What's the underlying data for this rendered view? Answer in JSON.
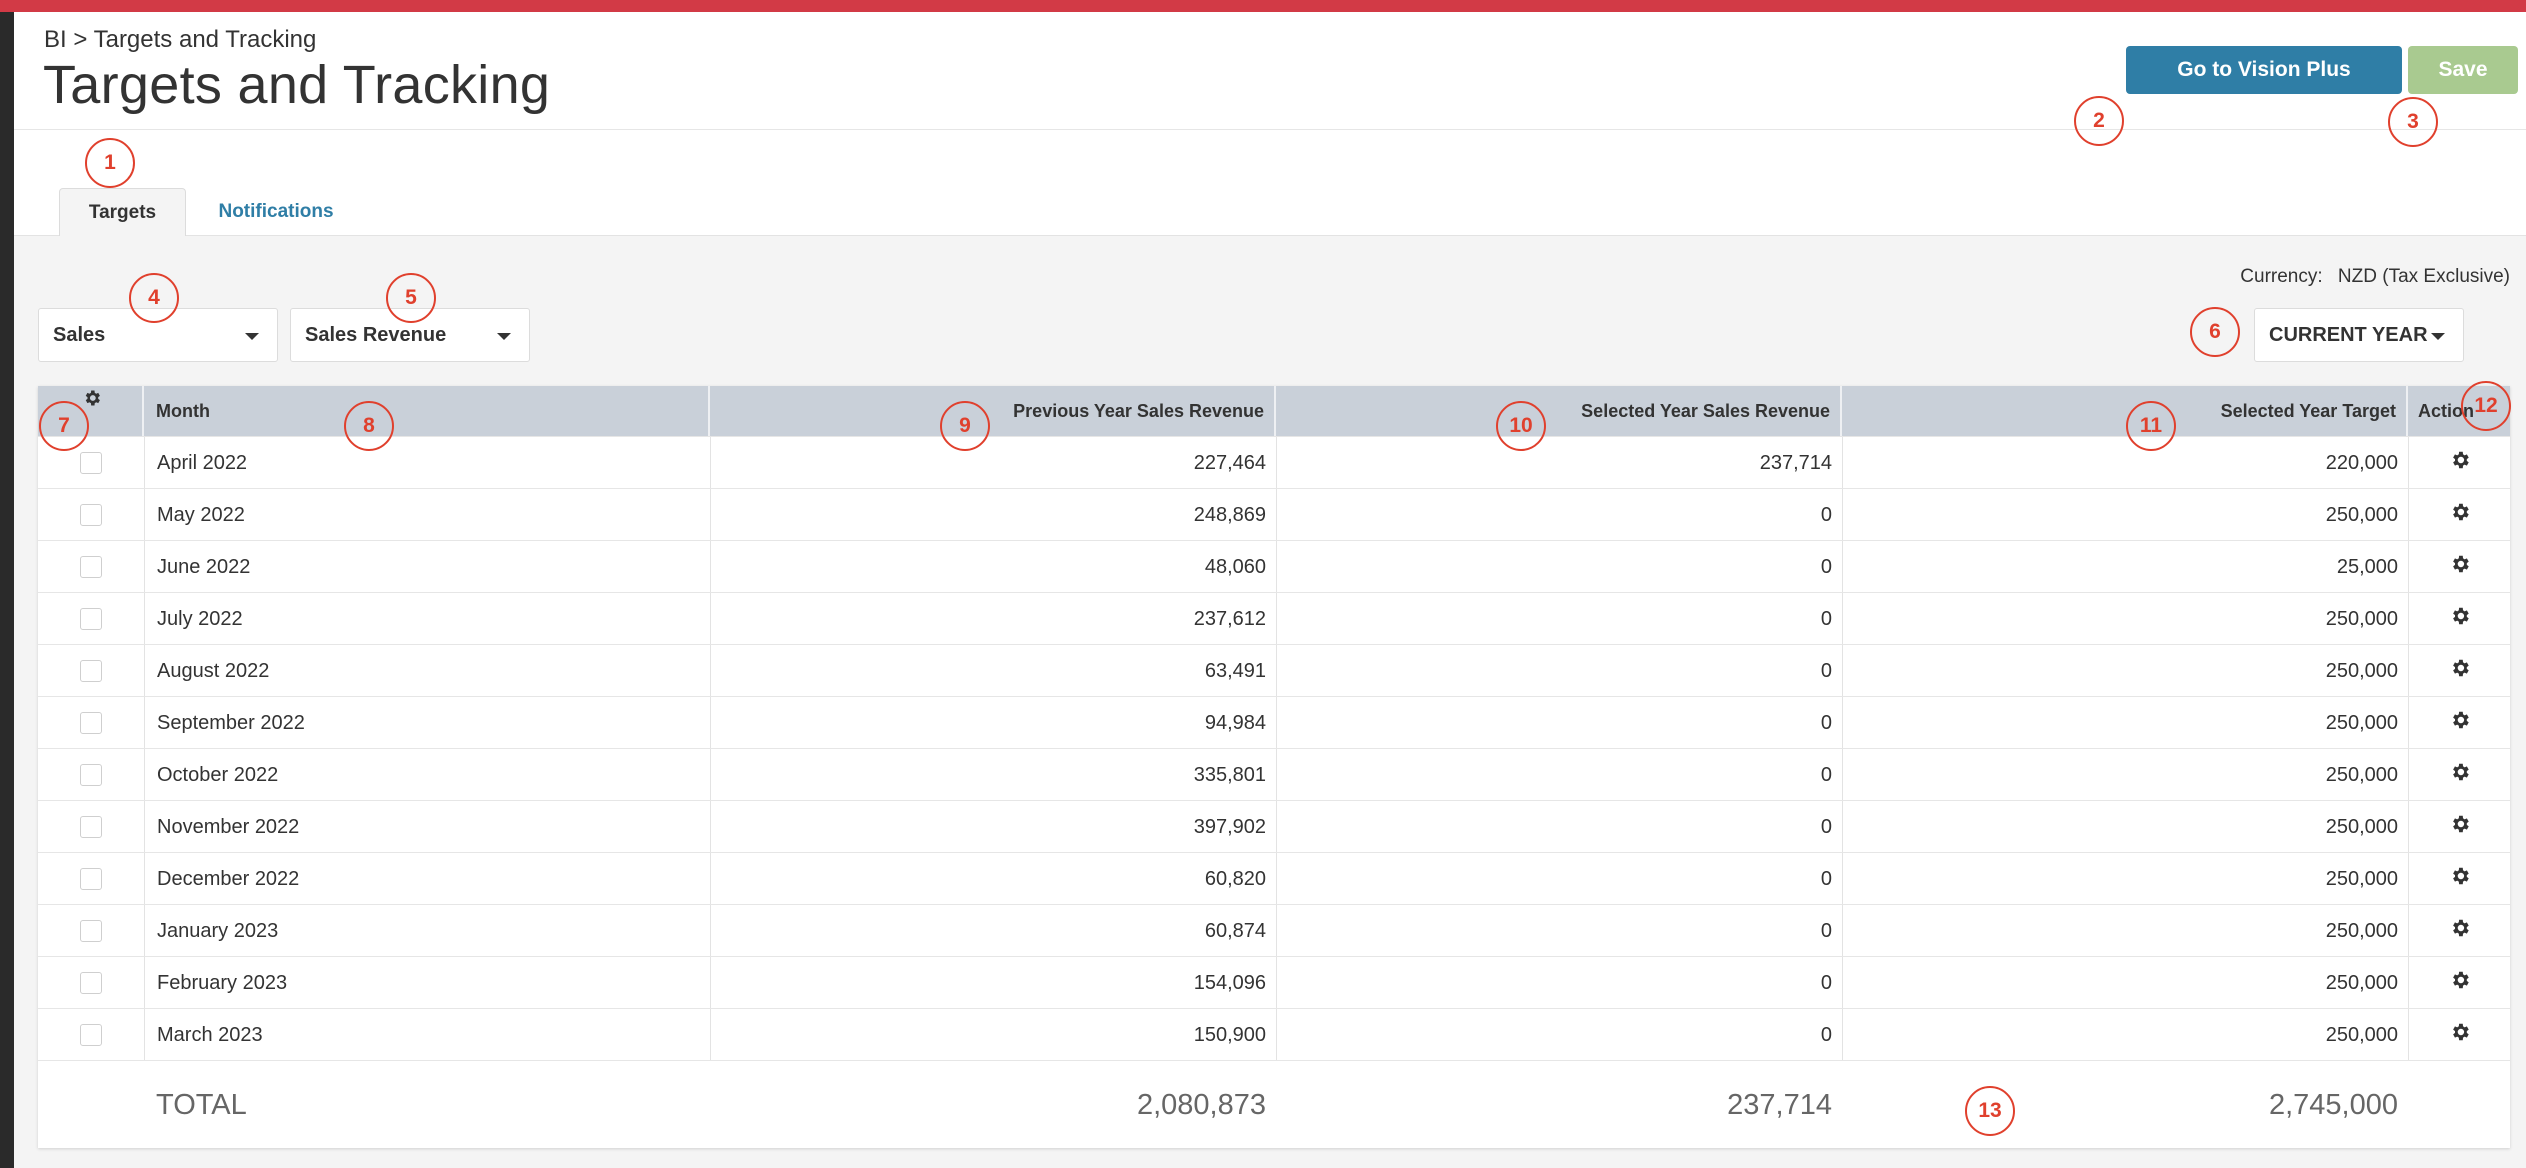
{
  "breadcrumb": "BI > Targets and Tracking",
  "page_title": "Targets and Tracking",
  "buttons": {
    "vision_plus": "Go to Vision Plus",
    "save": "Save"
  },
  "tabs": [
    {
      "label": "Targets",
      "active": true
    },
    {
      "label": "Notifications",
      "active": false
    }
  ],
  "currency": {
    "label": "Currency:",
    "value": "NZD (Tax Exclusive)"
  },
  "filters": {
    "category": "Sales",
    "metric": "Sales Revenue",
    "year": "CURRENT YEAR"
  },
  "table": {
    "columns": {
      "month": "Month",
      "previous": "Previous Year Sales Revenue",
      "selected": "Selected Year Sales Revenue",
      "target": "Selected Year Target",
      "action": "Action"
    },
    "rows": [
      {
        "month": "April 2022",
        "previous": "227,464",
        "selected": "237,714",
        "target": "220,000"
      },
      {
        "month": "May 2022",
        "previous": "248,869",
        "selected": "0",
        "target": "250,000"
      },
      {
        "month": "June 2022",
        "previous": "48,060",
        "selected": "0",
        "target": "25,000"
      },
      {
        "month": "July 2022",
        "previous": "237,612",
        "selected": "0",
        "target": "250,000"
      },
      {
        "month": "August 2022",
        "previous": "63,491",
        "selected": "0",
        "target": "250,000"
      },
      {
        "month": "September 2022",
        "previous": "94,984",
        "selected": "0",
        "target": "250,000"
      },
      {
        "month": "October 2022",
        "previous": "335,801",
        "selected": "0",
        "target": "250,000"
      },
      {
        "month": "November 2022",
        "previous": "397,902",
        "selected": "0",
        "target": "250,000"
      },
      {
        "month": "December 2022",
        "previous": "60,820",
        "selected": "0",
        "target": "250,000"
      },
      {
        "month": "January 2023",
        "previous": "60,874",
        "selected": "0",
        "target": "250,000"
      },
      {
        "month": "February 2023",
        "previous": "154,096",
        "selected": "0",
        "target": "250,000"
      },
      {
        "month": "March 2023",
        "previous": "150,900",
        "selected": "0",
        "target": "250,000"
      }
    ],
    "total": {
      "label": "TOTAL",
      "previous": "2,080,873",
      "selected": "237,714",
      "target": "2,745,000"
    }
  },
  "markers": [
    "1",
    "2",
    "3",
    "4",
    "5",
    "6",
    "7",
    "8",
    "9",
    "10",
    "11",
    "12",
    "13"
  ],
  "colors": {
    "brand_red": "#d23a46",
    "primary_button": "#2f7ea6",
    "save_button": "#a9ca90",
    "marker": "#e0402d"
  },
  "icons": {
    "row_action": "gear-icon",
    "header": "gear-icon"
  }
}
